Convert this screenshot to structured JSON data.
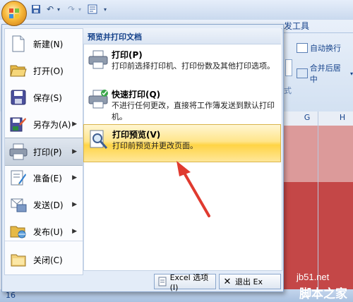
{
  "ribbon": {
    "tab_partial": "发工具",
    "cmd_wrap": "自动换行",
    "cmd_merge": "合并后居中",
    "group_label": "式"
  },
  "sheet": {
    "col_g": "G",
    "col_h": "H",
    "row_number": "16"
  },
  "menu": {
    "left_items": [
      {
        "label": "新建(N)",
        "icon": "new-document-icon",
        "has_arrow": false
      },
      {
        "label": "打开(O)",
        "icon": "open-folder-icon",
        "has_arrow": false
      },
      {
        "label": "保存(S)",
        "icon": "save-disk-icon",
        "has_arrow": false
      },
      {
        "label": "另存为(A)",
        "icon": "save-as-icon",
        "has_arrow": true
      },
      {
        "label": "打印(P)",
        "icon": "printer-icon",
        "has_arrow": true
      },
      {
        "label": "准备(E)",
        "icon": "prepare-icon",
        "has_arrow": true
      },
      {
        "label": "发送(D)",
        "icon": "send-icon",
        "has_arrow": true
      },
      {
        "label": "发布(U)",
        "icon": "publish-icon",
        "has_arrow": true
      },
      {
        "label": "关闭(C)",
        "icon": "close-folder-icon",
        "has_arrow": false
      }
    ],
    "right_header": "预览并打印文档",
    "sub_items": [
      {
        "title": "打印(P)",
        "desc": "打印前选择打印机、打印份数及其他打印选项。",
        "icon": "printer-icon"
      },
      {
        "title": "快速打印(Q)",
        "desc": "不进行任何更改，直接将工作簿发送到默认打印机。",
        "icon": "quick-print-icon"
      },
      {
        "title": "打印预览(V)",
        "desc": "打印前预览并更改页面。",
        "icon": "print-preview-icon"
      }
    ],
    "btn_options": "Excel 选项(I)",
    "btn_exit": "退出 Ex"
  },
  "watermark": {
    "line1": "jb51.net",
    "line2": "脚本之家"
  },
  "colors": {
    "highlight": "#ffd445",
    "menu_bg": "#e3ecf8",
    "sheet_red": "#c44747",
    "arrow": "#e03a2f"
  }
}
